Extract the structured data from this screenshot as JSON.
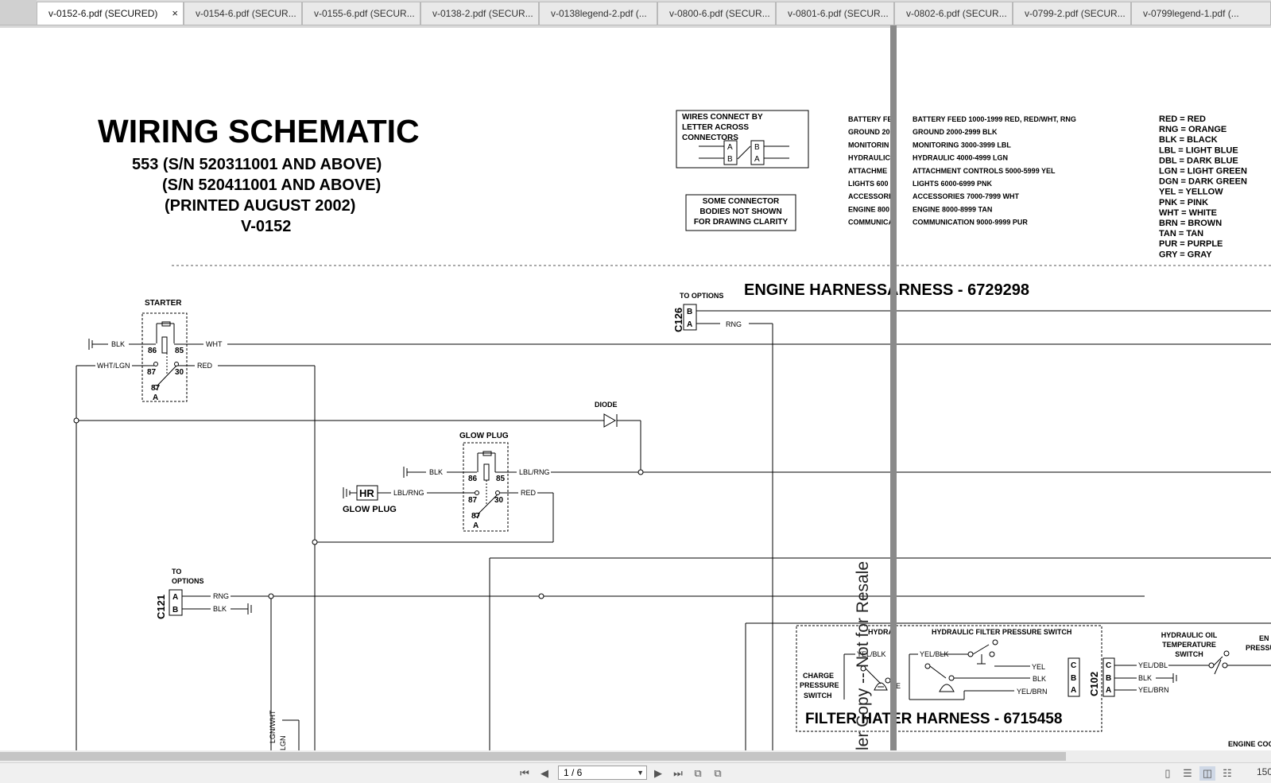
{
  "tabs": [
    {
      "label": "v-0152-6.pdf (SECURED)",
      "active": true
    },
    {
      "label": "v-0154-6.pdf (SECUR..."
    },
    {
      "label": "v-0155-6.pdf (SECUR..."
    },
    {
      "label": "v-0138-2.pdf (SECUR..."
    },
    {
      "label": "v-0138legend-2.pdf (..."
    },
    {
      "label": "v-0800-6.pdf (SECUR..."
    },
    {
      "label": "v-0801-6.pdf (SECUR..."
    },
    {
      "label": "v-0802-6.pdf (SECUR..."
    },
    {
      "label": "v-0799-2.pdf (SECUR..."
    },
    {
      "label": "v-0799legend-1.pdf (..."
    }
  ],
  "tab_close": "×",
  "doc": {
    "title": "WIRING SCHEMATIC",
    "subtitles": [
      "553 (S/N 520311001 AND ABOVE)",
      "(S/N 520411001 AND ABOVE)",
      "(PRINTED AUGUST 2002)",
      "V-0152"
    ],
    "connect_note": [
      "WIRES CONNECT BY",
      "LETTER ACROSS",
      "CONNECTORS"
    ],
    "connect_pins": [
      "A",
      "B",
      "B",
      "A"
    ],
    "connector_note": [
      "SOME CONNECTOR",
      "BODIES NOT SHOWN",
      "FOR DRAWING CLARITY"
    ],
    "feed_left": [
      "BATTERY FE",
      "GROUND 20",
      "MONITORIN",
      "HYDRAULIC",
      "ATTACHME",
      "LIGHTS 600",
      "ACCESSORI",
      "ENGINE 800",
      "COMMUNICA"
    ],
    "feed_right": [
      "BATTERY FEED 1000-1999 RED, RED/WHT, RNG",
      "GROUND 2000-2999 BLK",
      "MONITORING 3000-3999 LBL",
      "HYDRAULIC 4000-4999 LGN",
      "ATTACHMENT CONTROLS 5000-5999 YEL",
      "LIGHTS 6000-6999 PNK",
      "ACCESSORIES 7000-7999 WHT",
      "ENGINE 8000-8999 TAN",
      "COMMUNICATION 9000-9999 PUR"
    ],
    "color_legend": [
      "RED = RED",
      "RNG = ORANGE",
      "BLK = BLACK",
      "LBL = LIGHT BLUE",
      "DBL = DARK BLUE",
      "LGN = LIGHT GREEN",
      "DGN = DARK GREEN",
      "YEL = YELLOW",
      "PNK = PINK",
      "WHT = WHITE",
      "BRN = BROWN",
      "TAN = TAN",
      "PUR = PURPLE",
      "GRY = GRAY"
    ],
    "engine_harness": "ENGINE HARNESSARNESS - 6729298",
    "to_options": "TO  OPTIONS",
    "c126": {
      "id": "C126",
      "pins": [
        "B",
        "A"
      ],
      "wire": "RNG"
    },
    "starter": {
      "title": "STARTER",
      "wires": [
        "BLK",
        "WHT",
        "WHT/LGN",
        "RED"
      ],
      "pins": [
        "86",
        "85",
        "87",
        "30",
        "87",
        "A"
      ]
    },
    "diode": "DIODE",
    "glow_relay": {
      "title": "GLOW PLUG",
      "wires": [
        "BLK",
        "LBL/RNG",
        "LBL/RNG",
        "RED"
      ],
      "pins": [
        "86",
        "85",
        "87",
        "30",
        "87",
        "A"
      ]
    },
    "hr": {
      "label": "HR",
      "caption": "GLOW PLUG"
    },
    "c121": {
      "id": "C121",
      "to_options": [
        "TO",
        "OPTIONS"
      ],
      "pins": [
        "A",
        "B"
      ],
      "wires": [
        "RNG",
        "BLK"
      ]
    },
    "lgn_labels": [
      "LGN/WHT",
      "LGN"
    ],
    "hyd_box": {
      "title": "HYDRAULIC FILTER PRESSURE SWITCH",
      "hydra": "HYDRA",
      "charge": [
        "CHARGE",
        "PRESSURE",
        "SWITCH"
      ],
      "wires": [
        "YEL/BLK",
        "YEL/BLK",
        "YEL",
        "BLK",
        "YEL/BRN"
      ],
      "e": "E"
    },
    "c102": {
      "id": "C102",
      "pins": [
        "C",
        "B",
        "A"
      ],
      "pins2": [
        "C",
        "B",
        "A"
      ],
      "wires": [
        "YEL/DBL",
        "BLK",
        "YEL/BRN"
      ]
    },
    "oil_temp": [
      "HYDRAULIC OIL",
      "TEMPERATURE",
      "SWITCH"
    ],
    "engine_partial": [
      "EN",
      "PRESSU"
    ],
    "filter_harness": "FILTER HATER HARNESS - 6715458",
    "engine_coolant": "ENGINE COO",
    "watermark": "ler Copy -- Not for Resale"
  },
  "status": {
    "page_value": "1 / 6",
    "zoom": "150",
    "icons": [
      "first-page-icon",
      "prev-page-icon",
      "next-page-icon",
      "last-page-icon",
      "go-back-icon",
      "go-forward-icon",
      "single-page-icon",
      "continuous-icon",
      "facing-icon",
      "continuous-facing-icon"
    ]
  }
}
